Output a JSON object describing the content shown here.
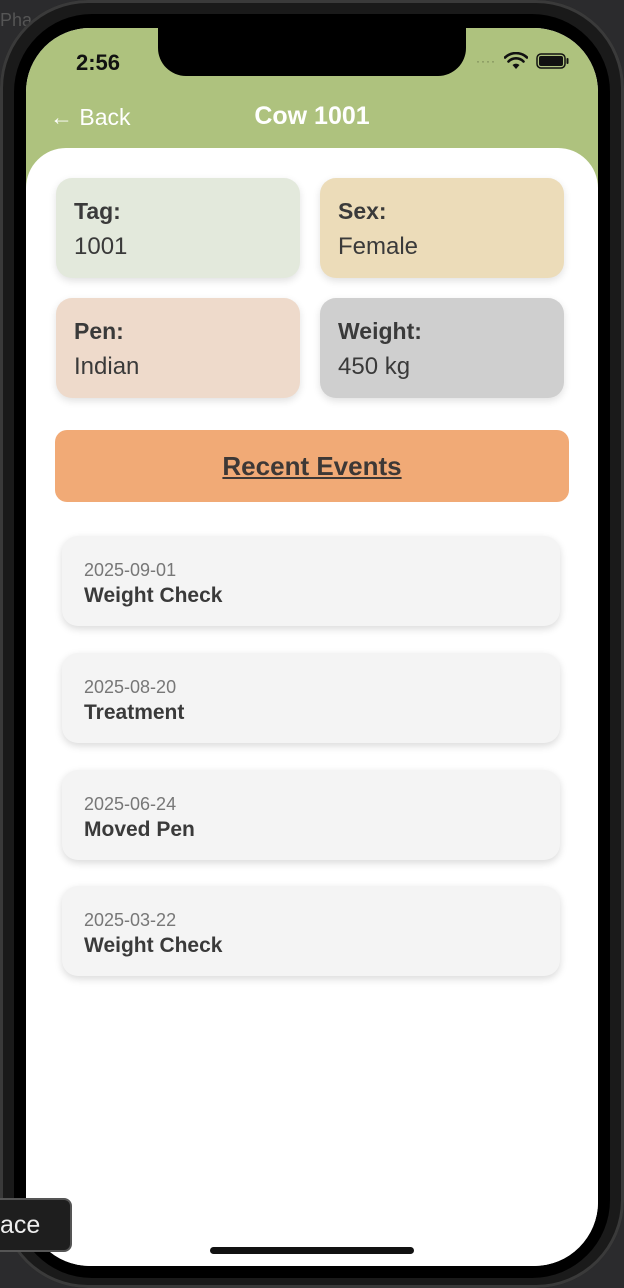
{
  "background": {
    "ghost_text": "Pha"
  },
  "status_bar": {
    "time": "2:56"
  },
  "nav": {
    "back_label": "← Back",
    "title": "Cow 1001"
  },
  "info": {
    "tag": {
      "label": "Tag:",
      "value": "1001",
      "color": "#e3e9dc"
    },
    "sex": {
      "label": "Sex:",
      "value": "Female",
      "color": "#ecdcb9"
    },
    "pen": {
      "label": "Pen:",
      "value": "Indian",
      "color": "#eedacb"
    },
    "weight": {
      "label": "Weight:",
      "value": "450 kg",
      "color": "#cfcfcf"
    }
  },
  "events_header": "Recent Events",
  "events": [
    {
      "date": "2025-09-01",
      "name": "Weight Check"
    },
    {
      "date": "2025-08-20",
      "name": "Treatment"
    },
    {
      "date": "2025-06-24",
      "name": "Moved Pen"
    },
    {
      "date": "2025-03-22",
      "name": "Weight Check"
    }
  ],
  "overlay": {
    "space_key_label": "ace"
  },
  "colors": {
    "header": "#aec27e",
    "events_header": "#f1aa76"
  }
}
